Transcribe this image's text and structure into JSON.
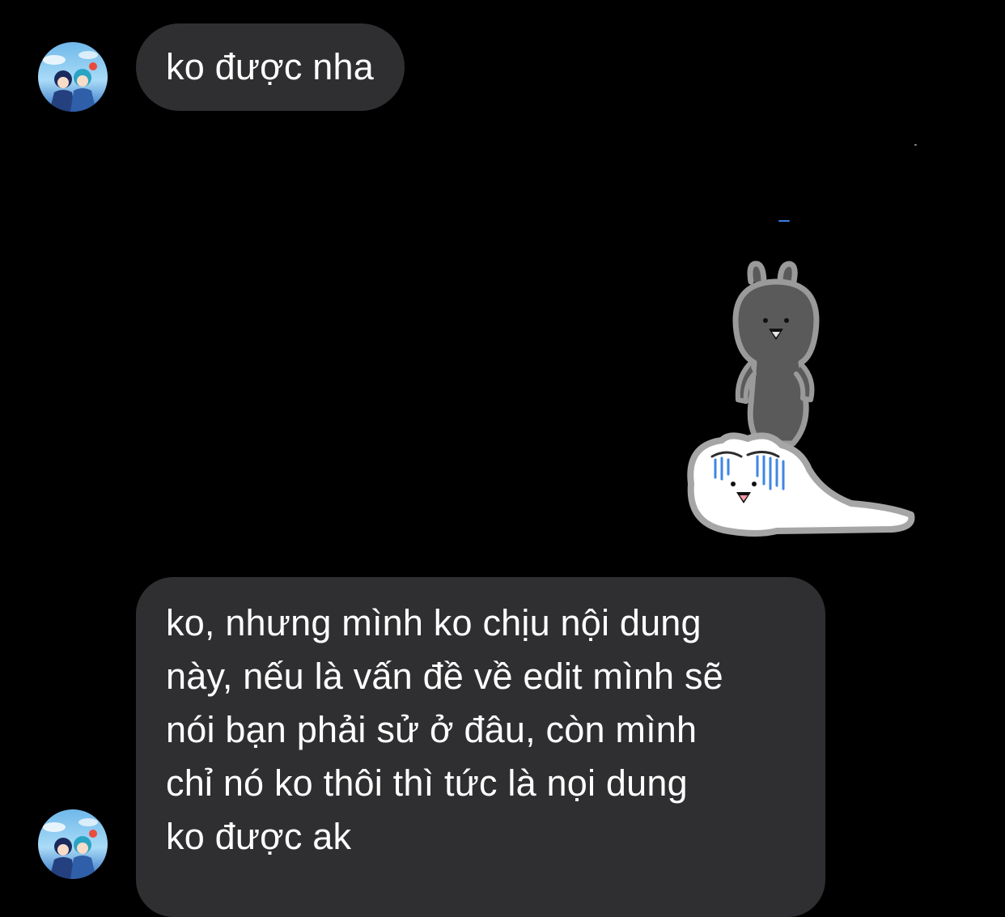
{
  "messages": [
    {
      "sender": "other",
      "avatar": "anime-avatar-icon",
      "text": "ko được nha"
    },
    {
      "sender": "self",
      "type": "sticker",
      "sticker": "rabbit-ghost-sticker"
    },
    {
      "sender": "other",
      "avatar": "anime-avatar-icon",
      "lines": [
        "ko, nhưng mình ko chịu nội dung",
        "này, nếu là vấn đề về edit mình sẽ",
        "nói bạn phải sử ở đâu, còn mình",
        "chỉ nó ko thôi thì tức là nọi dung",
        "ko được ak"
      ]
    }
  ],
  "colors": {
    "background": "#000000",
    "bubble": "#2f2f31",
    "text": "#ffffff",
    "accent": "#3b7fe0"
  }
}
